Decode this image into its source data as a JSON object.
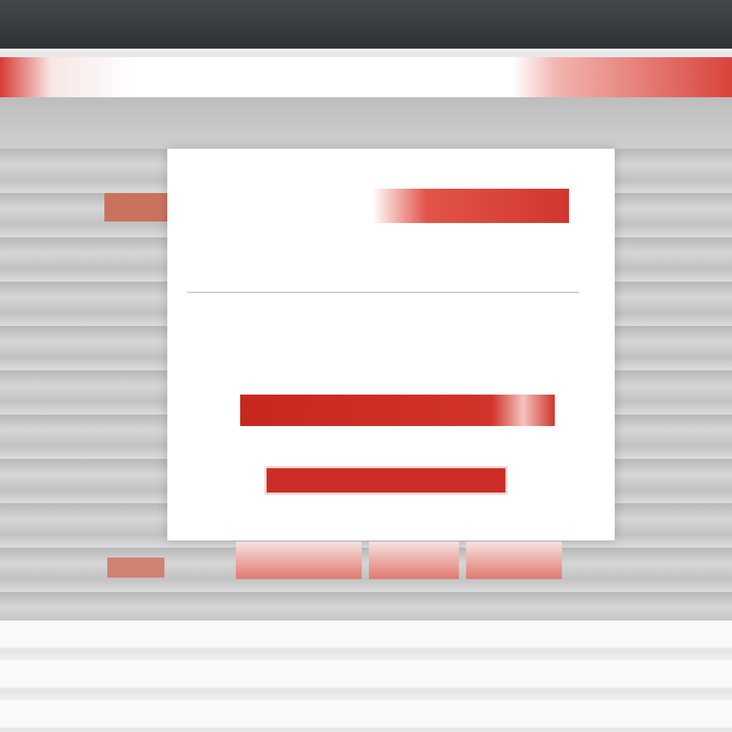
{
  "topbar": {
    "title": ""
  },
  "nav": {
    "left_label": "",
    "right_label": ""
  },
  "dialog": {
    "header_small": "",
    "title": "",
    "line1": "",
    "line2": "",
    "line3": "",
    "line4": "",
    "line5": "",
    "primary_button": "",
    "secondary_button": "",
    "footnote": ""
  },
  "bottom_tabs": [
    "",
    "",
    ""
  ],
  "sidebar": {
    "left_badge": "",
    "right_badge": ""
  },
  "footer": {
    "line1": "",
    "line2": ""
  },
  "colors": {
    "accent": "#cc2d26",
    "topbar": "#3a3e43",
    "dialog_bg": "#ffffff",
    "page_bg": "#c8c8c8"
  }
}
